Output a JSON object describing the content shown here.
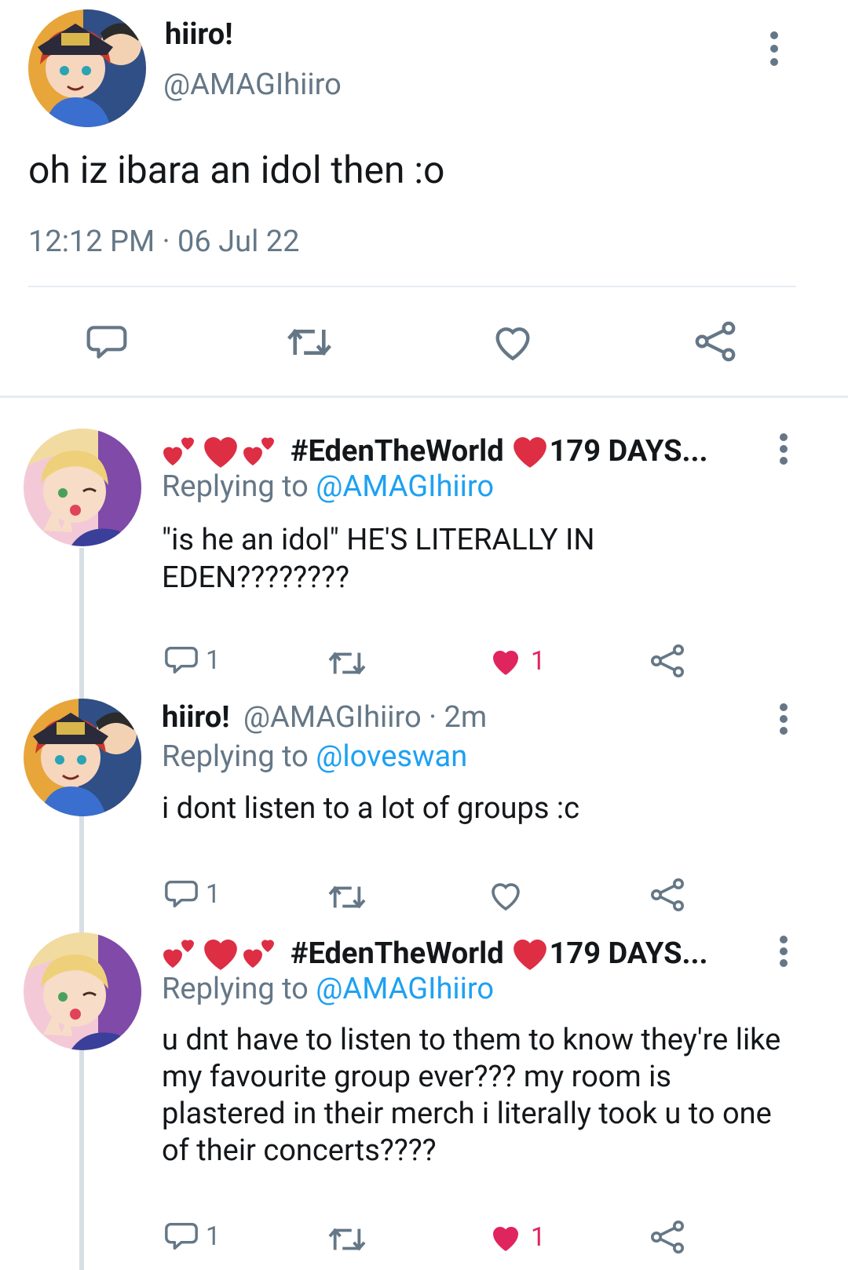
{
  "main_tweet": {
    "display_name": "hiiro!",
    "handle": "@AMAGIhiiro",
    "text": "oh iz ibara an idol then :o",
    "time": "12:12 PM",
    "separator": "·",
    "date": "06 Jul 22"
  },
  "replies": [
    {
      "display_name": "#EdenTheWorld",
      "name_suffix": "179 DAYS...",
      "replying_prefix": "Replying to ",
      "replying_to": "@AMAGIhiiro",
      "text": "\"is he an idol\" HE'S LITERALLY IN EDEN????????",
      "reply_count": "1",
      "like_count": "1",
      "liked": true
    },
    {
      "display_name": "hiiro!",
      "handle": "@AMAGIhiiro",
      "time_ago": "· 2m",
      "replying_prefix": "Replying to ",
      "replying_to": "@loveswan",
      "text": "i dont listen to a lot of groups :c",
      "reply_count": "1",
      "liked": false
    },
    {
      "display_name": "#EdenTheWorld",
      "name_suffix": "179 DAYS...",
      "replying_prefix": "Replying to ",
      "replying_to": "@AMAGIhiiro",
      "text": "u dnt have to listen to them to know they're like my favourite group ever??? my room is plastered in their merch i literally took u to one of their concerts????",
      "reply_count": "1",
      "like_count": "1",
      "liked": true
    }
  ],
  "icons": [
    "reply-icon",
    "retweet-icon",
    "like-icon",
    "share-icon",
    "more-options-icon",
    "heart-emoji",
    "two-hearts-emoji"
  ],
  "colors": {
    "link": "#1da1f2",
    "muted": "#657786",
    "like": "#e0245e",
    "emoji_red": "#dd2e44",
    "divider": "#e6ecf0"
  }
}
